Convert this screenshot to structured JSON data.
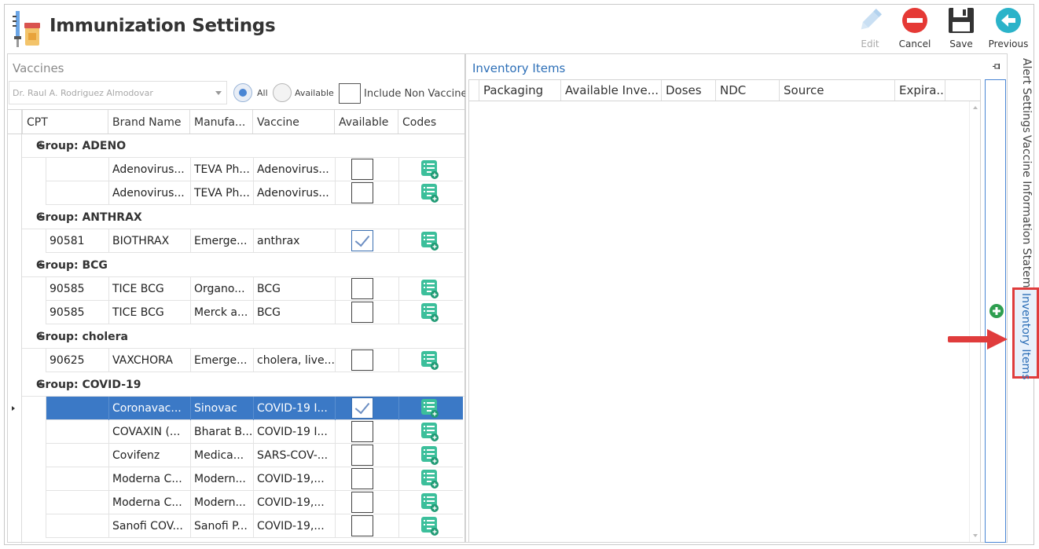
{
  "app": {
    "title": "Immunization Settings"
  },
  "toolbar": {
    "edit_label": "Edit",
    "cancel_label": "Cancel",
    "save_label": "Save",
    "previous_label": "Previous"
  },
  "vaccines": {
    "heading": "Vaccines",
    "provider": "Dr. Raul A. Rodriguez Almodovar",
    "filter_all": "All",
    "filter_available": "Available",
    "include_non_vaccines": "Include Non Vaccines",
    "columns": [
      "CPT",
      "Brand Name",
      "Manufa...",
      "Vaccine",
      "Available",
      "Codes"
    ],
    "groups": [
      {
        "label": "Group: ADENO",
        "rows": [
          {
            "cpt": "",
            "brand": "Adenovirus...",
            "manu": "TEVA Ph...",
            "vaccine": "Adenovirus...",
            "available": false
          },
          {
            "cpt": "",
            "brand": "Adenovirus...",
            "manu": "TEVA Ph...",
            "vaccine": "Adenovirus...",
            "available": false
          }
        ]
      },
      {
        "label": "Group: ANTHRAX",
        "rows": [
          {
            "cpt": "90581",
            "brand": "BIOTHRAX",
            "manu": "Emerge...",
            "vaccine": "anthrax",
            "available": true
          }
        ]
      },
      {
        "label": "Group: BCG",
        "rows": [
          {
            "cpt": "90585",
            "brand": "TICE BCG",
            "manu": "Organo...",
            "vaccine": "BCG",
            "available": false
          },
          {
            "cpt": "90585",
            "brand": "TICE BCG",
            "manu": "Merck a...",
            "vaccine": "BCG",
            "available": false
          }
        ]
      },
      {
        "label": "Group: cholera",
        "rows": [
          {
            "cpt": "90625",
            "brand": "VAXCHORA",
            "manu": "Emerge...",
            "vaccine": "cholera, live...",
            "available": false
          }
        ]
      },
      {
        "label": "Group: COVID-19",
        "rows": [
          {
            "cpt": "",
            "brand": "Coronavac...",
            "manu": "Sinovac",
            "vaccine": "COVID-19 I...",
            "available": true,
            "selected": true
          },
          {
            "cpt": "",
            "brand": "COVAXIN (...",
            "manu": "Bharat B...",
            "vaccine": "COVID-19 I...",
            "available": false
          },
          {
            "cpt": "",
            "brand": "Covifenz",
            "manu": "Medica...",
            "vaccine": "SARS-COV-...",
            "available": false
          },
          {
            "cpt": "",
            "brand": "Moderna C...",
            "manu": "Modern...",
            "vaccine": "COVID-19,...",
            "available": false
          },
          {
            "cpt": "",
            "brand": "Moderna C...",
            "manu": "Modern...",
            "vaccine": "COVID-19,...",
            "available": false
          },
          {
            "cpt": "",
            "brand": "Sanofi COV...",
            "manu": "Sanofi P...",
            "vaccine": "COVID-19,...",
            "available": false
          }
        ]
      }
    ]
  },
  "inventory": {
    "heading": "Inventory Items",
    "columns": [
      "Packaging",
      "Available Inve...",
      "Doses",
      "NDC",
      "Source",
      "Expira..."
    ]
  },
  "side_tabs": [
    "Alert Settings",
    "Vaccine Information Statement",
    "Inventory Items"
  ],
  "colors": {
    "accent": "#3b79c6",
    "link": "#2d6fb7",
    "highlight_border": "#e03c3c",
    "codes_icon": "#3cbf9b"
  }
}
